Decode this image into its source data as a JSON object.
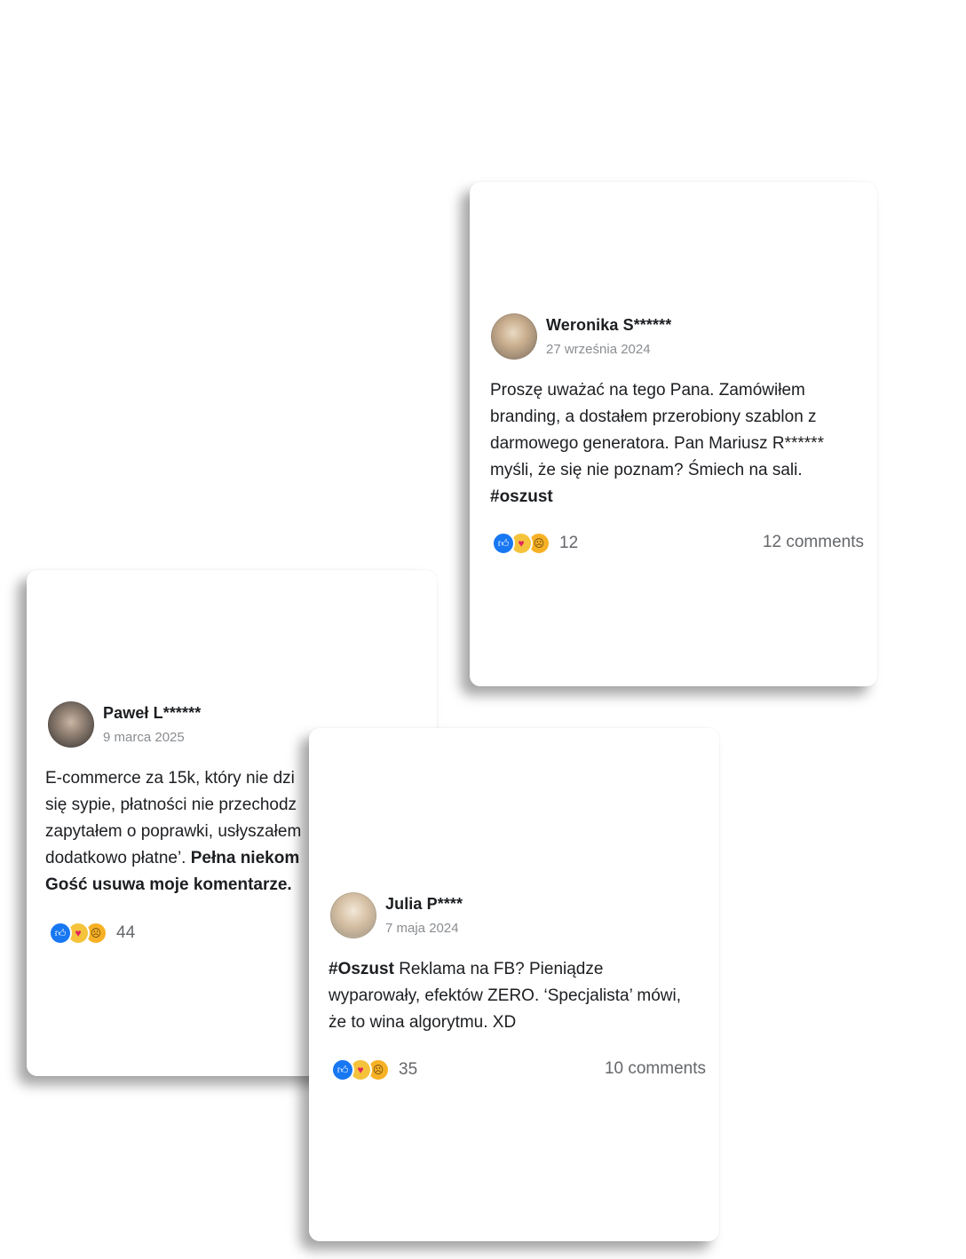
{
  "posts": [
    {
      "author": "Weronika S******",
      "date": "27 września 2024",
      "body_lines": [
        "Proszę uważać na tego Pana. Zamówiłem",
        "branding, a dostałem przerobiony szablon z",
        "darmowego generatora. Pan Mariusz R******",
        "myśli, że się nie poznam? Śmiech na sali."
      ],
      "hashtag": "#oszust",
      "reaction_count": "12",
      "comments": "12 comments"
    },
    {
      "author": "Paweł L******",
      "date": "9 marca 2025",
      "body_lines": [
        "E-commerce za 15k, który nie dzi",
        "się sypie, płatności nie przechodz",
        "zapytałem o poprawki, usłyszałem",
        "dodatkowo płatne’."
      ],
      "bold_tail": "Pełna niekom",
      "bold_line": "Gość usuwa moje komentarze.",
      "reaction_count": "44"
    },
    {
      "author": "Julia P****",
      "date": "7 maja 2024",
      "hashtag": "#Oszust",
      "body_first": "Reklama na FB? Pieniądze",
      "body_lines": [
        "wyparowały, efektów ZERO. ‘Specjalista’ mówi,",
        "że to wina algorytmu. XD"
      ],
      "reaction_count": "35",
      "comments": "10 comments"
    }
  ],
  "icons": {
    "like": "thumbs-up-icon",
    "love": "heart-face-icon",
    "sad": "sad-face-icon"
  },
  "colors": {
    "like": "#1877f2",
    "emoji": "#f5c33b",
    "muted_text": "#65676b",
    "date_text": "#8a8d91"
  }
}
